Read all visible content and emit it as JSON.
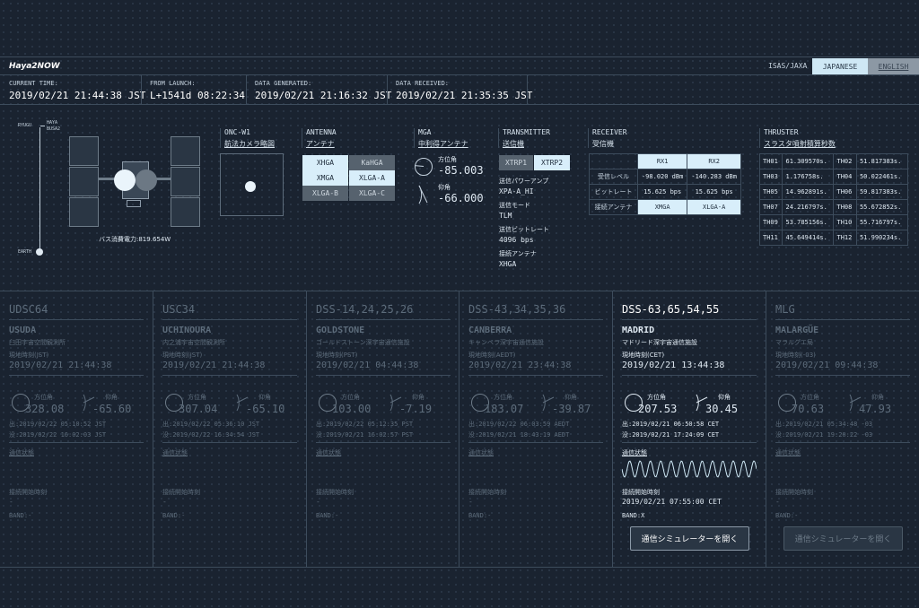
{
  "header": {
    "brand": "Haya2NOW",
    "org": "ISAS/JAXA",
    "lang_jp": "JAPANESE",
    "lang_en": "ENGLISH"
  },
  "times": [
    {
      "label": "CURRENT TIME:",
      "value": "2019/02/21 21:44:38 JST"
    },
    {
      "label": "FROM LAUNCH:",
      "value": "L+1541d 08:22:34"
    },
    {
      "label": "DATA GENERATED:",
      "value": "2019/02/21 21:16:32 JST"
    },
    {
      "label": "DATA RECEIVED:",
      "value": "2019/02/21 21:35:35 JST"
    }
  ],
  "spacecraft": {
    "label_ryugu": "RYUGU",
    "label_haya": "HAYA",
    "label_busa2": "BUSA2",
    "label_earth": "EARTH",
    "power": "バス消費電力:819.654W"
  },
  "onc": {
    "title": "ONC-W1",
    "sub": "航法カメラ略図"
  },
  "antenna": {
    "title": "ANTENNA",
    "sub": "アンテナ",
    "chips": [
      "XHGA",
      "KaHGA",
      "XMGA",
      "XLGA-A",
      "XLGA-B",
      "XLGA-C"
    ]
  },
  "mga": {
    "title": "MGA",
    "sub": "中利得アンテナ",
    "az_label": "方位角",
    "az_value": "-85.003",
    "el_label": "仰角",
    "el_value": "-66.000"
  },
  "transmitter": {
    "title": "TRANSMITTER",
    "sub": "送信機",
    "chips": [
      "XTRP1",
      "XTRP2"
    ],
    "items": [
      {
        "label": "送信パワーアンプ",
        "value": "XPA-A_HI"
      },
      {
        "label": "送信モード",
        "value": "TLM"
      },
      {
        "label": "送信ビットレート",
        "value": "4096 bps"
      },
      {
        "label": "接続アンテナ",
        "value": "XHGA"
      }
    ]
  },
  "receiver": {
    "title": "RECEIVER",
    "sub": "受信機",
    "cols": [
      "RX1",
      "RX2"
    ],
    "rows": [
      {
        "label": "受信レベル",
        "v1": "-98.020 dBm",
        "v2": "-140.283 dBm"
      },
      {
        "label": "ビットレート",
        "v1": "15.625 bps",
        "v2": "15.625 bps"
      },
      {
        "label": "接続アンテナ",
        "v1": "XMGA",
        "v2": "XLGA-A"
      }
    ]
  },
  "thruster": {
    "title": "THRUSTER",
    "sub": "スラスタ噴射積算秒数",
    "rows": [
      [
        "TH01",
        "61.309570s.",
        "TH02",
        "51.817383s."
      ],
      [
        "TH03",
        "1.176758s.",
        "TH04",
        "50.022461s."
      ],
      [
        "TH05",
        "14.962891s.",
        "TH06",
        "59.817383s."
      ],
      [
        "TH07",
        "24.216797s.",
        "TH08",
        "55.672852s."
      ],
      [
        "TH09",
        "53.785156s.",
        "TH10",
        "55.716797s."
      ],
      [
        "TH11",
        "45.649414s.",
        "TH12",
        "51.990234s."
      ]
    ]
  },
  "stations": [
    {
      "code": "UDSC64",
      "name": "USUDA",
      "jpname": "臼田宇宙空間観測所",
      "tz": "現地時刻(JST)",
      "ltime": "2019/02/21 21:44:38",
      "az_label": "方位角",
      "az": "328.08",
      "el_label": "仰角",
      "el": "-65.60",
      "rise": "出:2019/02/22 05:10:52 JST",
      "set": "没:2019/02/22 16:02:03 JST",
      "cs": "通信状態",
      "cst": "接続開始時刻",
      "cstv": "-",
      "band": "BAND:-",
      "btn": ""
    },
    {
      "code": "USC34",
      "name": "UCHINOURA",
      "jpname": "内之浦宇宙空間観測所",
      "tz": "現地時刻(JST)",
      "ltime": "2019/02/21 21:44:38",
      "az_label": "方位角",
      "az": "307.04",
      "el_label": "仰角",
      "el": "-65.10",
      "rise": "出:2019/02/22 05:36:10 JST",
      "set": "没:2019/02/22 16:34:54 JST",
      "cs": "通信状態",
      "cst": "接続開始時刻",
      "cstv": "-",
      "band": "BAND:-",
      "btn": ""
    },
    {
      "code": "DSS-14,24,25,26",
      "name": "GOLDSTONE",
      "jpname": "ゴールドストーン深宇宙通信施設",
      "tz": "現地時刻(PST)",
      "ltime": "2019/02/21 04:44:38",
      "az_label": "方位角",
      "az": "103.00",
      "el_label": "仰角",
      "el": "-7.19",
      "rise": "出:2019/02/22 05:12:35 PST",
      "set": "没:2019/02/21 16:02:57 PST",
      "cs": "通信状態",
      "cst": "接続開始時刻",
      "cstv": "-",
      "band": "BAND:-",
      "btn": ""
    },
    {
      "code": "DSS-43,34,35,36",
      "name": "CANBERRA",
      "jpname": "キャンベラ深宇宙通信施設",
      "tz": "現地時刻(AEDT)",
      "ltime": "2019/02/21 23:44:38",
      "az_label": "方位角",
      "az": "183.07",
      "el_label": "仰角",
      "el": "-39.87",
      "rise": "出:2019/02/22 06:03:59 AEDT",
      "set": "没:2019/02/21 18:43:19 AEDT",
      "cs": "通信状態",
      "cst": "接続開始時刻",
      "cstv": "-",
      "band": "BAND:-",
      "btn": ""
    },
    {
      "code": "DSS-63,65,54,55",
      "name": "MADRID",
      "jpname": "マドリード深宇宙通信施設",
      "tz": "現地時刻(CET)",
      "ltime": "2019/02/21 13:44:38",
      "az_label": "方位角",
      "az": "207.53",
      "el_label": "仰角",
      "el": "30.45",
      "rise": "出:2019/02/21 06:50:58 CET",
      "set": "没:2019/02/21 17:24:09 CET",
      "cs": "通信状態",
      "cst": "接続開始時刻",
      "cstv": "2019/02/21 07:55:00 CET",
      "band": "BAND:X",
      "btn": "通信シミュレーターを開く"
    },
    {
      "code": "MLG",
      "name": "MALARGÜE",
      "jpname": "マラルグエ局",
      "tz": "現地時刻(-03)",
      "ltime": "2019/02/21 09:44:38",
      "az_label": "方位角",
      "az": "70.63",
      "el_label": "仰角",
      "el": "47.93",
      "rise": "出:2019/02/21 05:34:48 -03",
      "set": "没:2019/02/21 19:20:22 -03",
      "cs": "通信状態",
      "cst": "接続開始時刻",
      "cstv": "-",
      "band": "BAND:-",
      "btn": "通信シミュレーターを開く"
    }
  ],
  "colors": {
    "bg": "#1a2330",
    "accent": "#d8eefa",
    "line": "#3d4c5c"
  }
}
